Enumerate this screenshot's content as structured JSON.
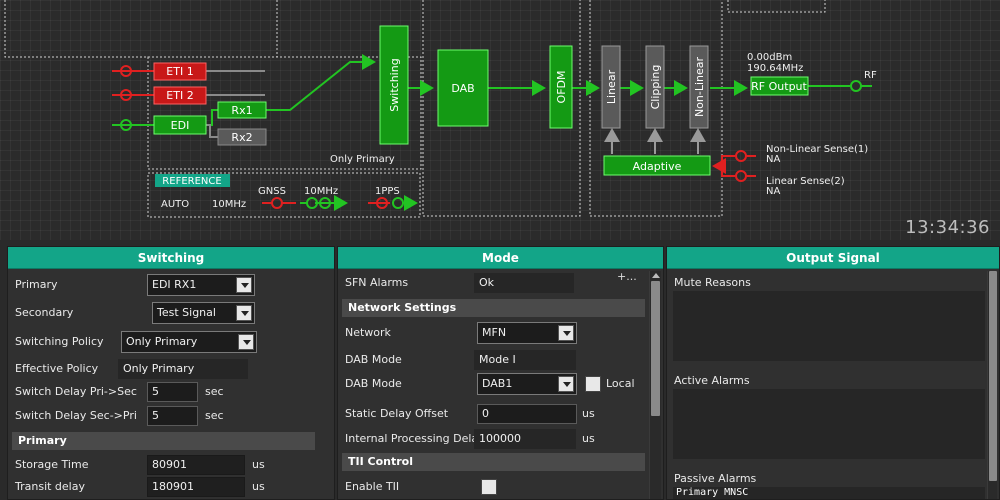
{
  "diagram": {
    "inputs": {
      "eti1": "ETI 1",
      "eti2": "ETI 2",
      "edi": "EDI",
      "rx1": "Rx1",
      "rx2": "Rx2"
    },
    "switching_block": "Switching",
    "only_primary": "Only Primary",
    "dab_block": "DAB",
    "ofdm_block": "OFDM",
    "linear_block": "Linear",
    "clipping_block": "Clipping",
    "nonlinear_block": "Non-Linear",
    "adaptive_block": "Adaptive",
    "power": "0.00dBm",
    "frequency": "190.64MHz",
    "rf_output": "RF Output",
    "rf": "RF",
    "sense1_label": "Non-Linear Sense(1)",
    "sense1_value": "NA",
    "sense2_label": "Linear Sense(2)",
    "sense2_value": "NA",
    "reference": {
      "badge": "REFERENCE",
      "mode": "AUTO",
      "freq": "10MHz",
      "gnss": "GNSS",
      "tenmhz": "10MHz",
      "pps": "1PPS"
    },
    "clock": "13:34:36",
    "colors": {
      "green": "#22c422",
      "red": "#e02020",
      "teal": "#13a588"
    }
  },
  "switching_panel": {
    "title": "Switching",
    "primary_label": "Primary",
    "primary_value": "EDI RX1",
    "secondary_label": "Secondary",
    "secondary_value": "Test Signal",
    "policy_label": "Switching Policy",
    "policy_value": "Only Primary",
    "effective_label": "Effective Policy",
    "effective_value": "Only Primary",
    "delay_pri_label": "Switch Delay Pri->Sec",
    "delay_pri_value": "5",
    "delay_sec_label": "Switch Delay Sec->Pri",
    "delay_sec_value": "5",
    "sec_unit": "sec",
    "primary_section": "Primary",
    "storage_label": "Storage Time",
    "storage_value": "80901",
    "transit_label": "Transit delay",
    "transit_value": "180901",
    "us_unit": "us"
  },
  "mode_panel": {
    "title": "Mode",
    "sfn_label": "SFN Alarms",
    "sfn_value": "Ok",
    "expand": "+...",
    "network_section": "Network Settings",
    "network_label": "Network",
    "network_value": "MFN",
    "dabmode_label": "DAB Mode",
    "dabmode_value": "Mode I",
    "dabmode2_label": "DAB Mode",
    "dabmode2_value": "DAB1",
    "local_label": "Local",
    "static_label": "Static Delay Offset",
    "static_value": "0",
    "internal_label": "Internal Processing Delay",
    "internal_value": "100000",
    "us_unit": "us",
    "tii_section": "TII Control",
    "tii_label": "Enable TII"
  },
  "output_panel": {
    "title": "Output Signal",
    "mute_label": "Mute Reasons",
    "active_label": "Active Alarms",
    "passive_label": "Passive Alarms",
    "passive_text": "Primary MNSC"
  }
}
